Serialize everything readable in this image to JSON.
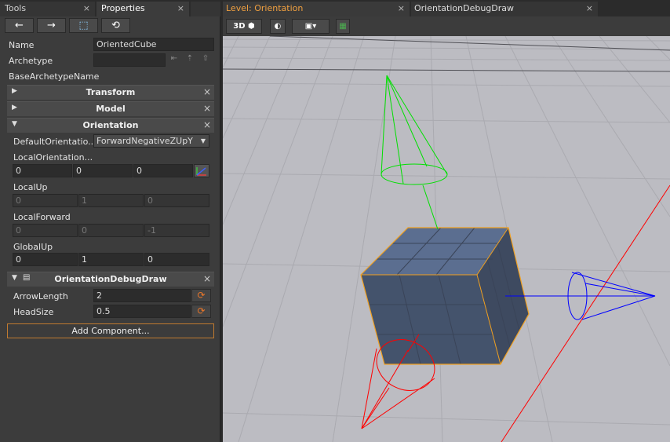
{
  "left_tabs": [
    {
      "label": "Tools",
      "close": "×"
    },
    {
      "label": "Properties",
      "close": "×"
    }
  ],
  "nav": {
    "back": "←",
    "forward": "→",
    "select": "⬚",
    "history": "⟲"
  },
  "name": {
    "label": "Name",
    "value": "OrientedCube"
  },
  "archetype": {
    "label": "Archetype",
    "value": ""
  },
  "base_archetype": {
    "label": "BaseArchetypeName"
  },
  "sections": {
    "transform": "Transform",
    "model": "Model",
    "orientation": "Orientation",
    "debugdraw": "OrientationDebugDraw"
  },
  "orientation": {
    "default_label": "DefaultOrientatio...",
    "default_value": "ForwardNegativeZUpY",
    "local_orientation_label": "LocalOrientation...",
    "local_orientation": [
      "0",
      "0",
      "0"
    ],
    "local_up_label": "LocalUp",
    "local_up": [
      "0",
      "1",
      "0"
    ],
    "local_forward_label": "LocalForward",
    "local_forward": [
      "0",
      "0",
      "-1"
    ],
    "global_up_label": "GlobalUp",
    "global_up": [
      "0",
      "1",
      "0"
    ]
  },
  "debugdraw": {
    "arrow_length_label": "ArrowLength",
    "arrow_length": "2",
    "head_size_label": "HeadSize",
    "head_size": "0.5"
  },
  "add_component": "Add Component...",
  "view_tabs": [
    {
      "label": "Level: Orientation",
      "close": "×"
    },
    {
      "label": "OrientationDebugDraw",
      "close": "×"
    }
  ],
  "toolbar": {
    "mode": "3D"
  },
  "colors": {
    "accent": "#f0a040",
    "x_axis": "#ff0000",
    "y_axis": "#00e000",
    "z_axis": "#0000ff",
    "selection": "#f0a020"
  }
}
